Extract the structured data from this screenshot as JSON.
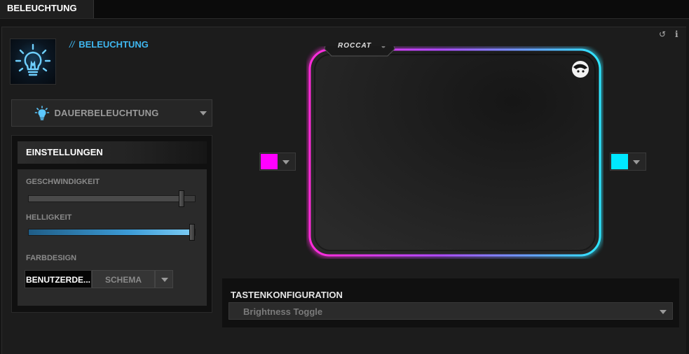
{
  "tabs": [
    {
      "label": "BELEUCHTUNG",
      "active": true
    }
  ],
  "section_title": "BELEUCHTUNG",
  "section_prefix": "//",
  "toolbar": {
    "reset_glyph": "↺",
    "info_glyph": "i"
  },
  "mode": {
    "label": "DAUERBELEUCHTUNG",
    "icon": "lightbulb-icon"
  },
  "settings": {
    "header": "EINSTELLUNGEN",
    "speed": {
      "label": "GESCHWINDIGKEIT",
      "value": 0.92
    },
    "brightness": {
      "label": "HELLIGKEIT",
      "value": 1.0
    },
    "colordesign": {
      "label": "FARBDESIGN",
      "option_a": "BENUTZERDE...",
      "option_b": "SCHEMA",
      "selected": "option_a"
    }
  },
  "colors": {
    "left": "#ff00ff",
    "right": "#00e8ff",
    "accent": "#3fb7f0",
    "mat_glow_left": "#ff2bd9",
    "mat_glow_right": "#2ee6ff"
  },
  "mat": {
    "brand": "ROCCAT"
  },
  "keyconfig": {
    "title": "TASTENKONFIGURATION",
    "value": "Brightness Toggle"
  }
}
